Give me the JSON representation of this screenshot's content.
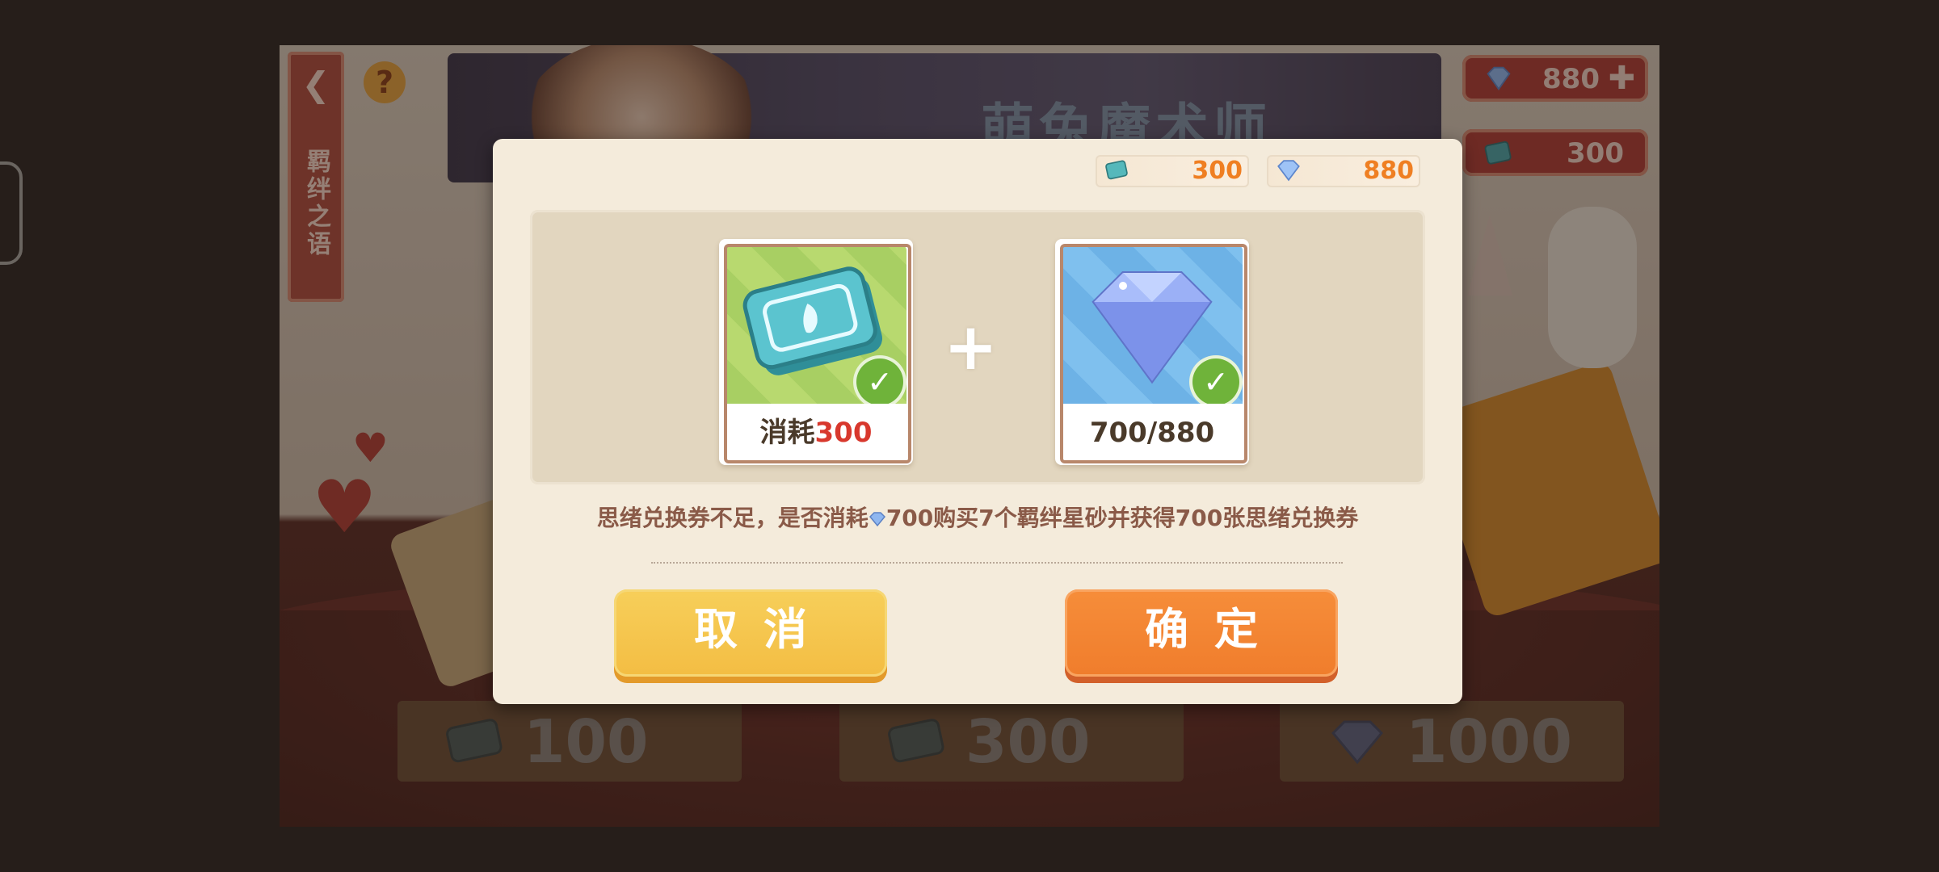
{
  "background": {
    "banner_title": "萌兔魔术师",
    "side_tab_label": "羁绊之语",
    "help_label": "?",
    "top_gem_value": "880",
    "top_ticket_value": "300",
    "bottom_options": [
      {
        "value": "100",
        "icon": "ticket-icon"
      },
      {
        "value": "300",
        "icon": "ticket-icon"
      },
      {
        "value": "1000",
        "icon": "gem-icon"
      }
    ]
  },
  "dialog": {
    "ticket_balance": "300",
    "gem_balance": "880",
    "ticket_card": {
      "label_prefix": "消耗",
      "label_cost": "300",
      "checked": true
    },
    "gem_card": {
      "label": "700/880",
      "checked": true
    },
    "plus": "+",
    "message_before": "思绪兑换券不足，是否消耗",
    "message_after": "700购买7个羁绊星砂并获得700张思绪兑换券",
    "cancel_label": "取消",
    "confirm_label": "确定"
  },
  "colors": {
    "accent_orange": "#ef7f22",
    "cancel_yellow": "#f3bd43",
    "confirm_orange": "#f07d2c",
    "cost_red": "#d8382d",
    "check_green": "#6fb33a"
  }
}
